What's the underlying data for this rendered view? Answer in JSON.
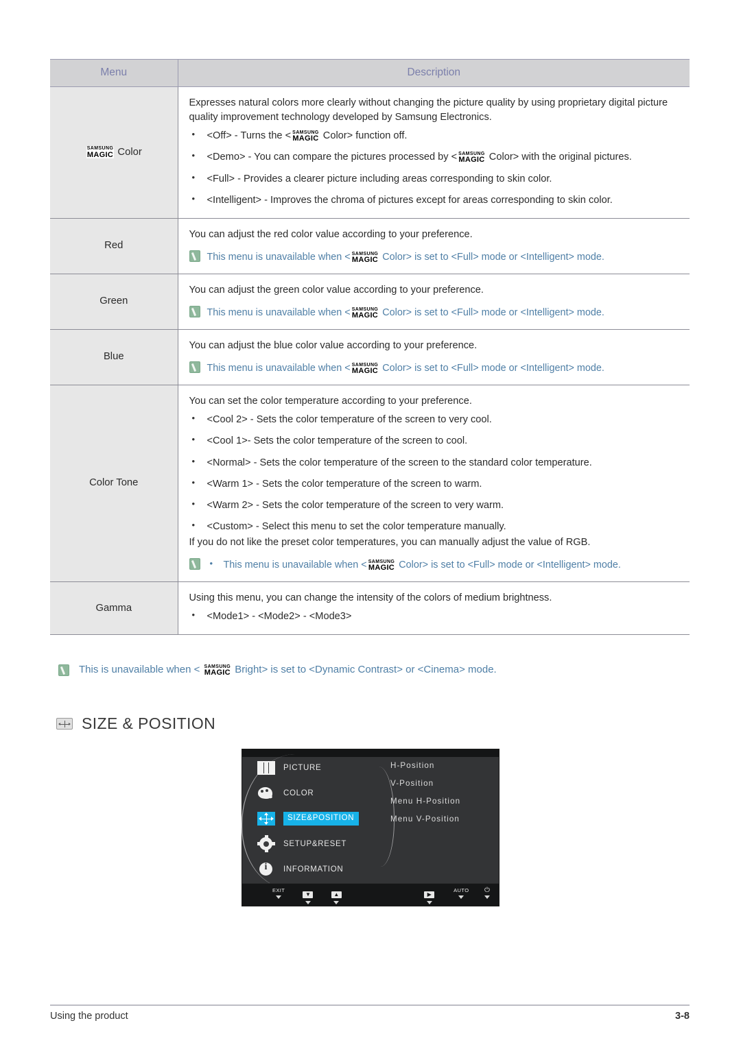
{
  "table": {
    "headers": {
      "menu": "Menu",
      "description": "Description"
    },
    "rows": [
      {
        "menu_prefix": "",
        "menu_magic": true,
        "menu_label": "Color",
        "intro": "Expresses natural colors more clearly without changing the picture quality by using proprietary digital picture quality improvement technology developed by Samsung Electronics.",
        "bullets": [
          {
            "pre": "<Off> - Turns the <",
            "magic": true,
            "post": " Color> function off."
          },
          {
            "pre": "<Demo> - You can compare the pictures processed by <",
            "magic": true,
            "post": " Color> with the original pictures."
          },
          {
            "pre": "<Full> - Provides a clearer picture including areas corresponding to skin color.",
            "magic": false,
            "post": ""
          },
          {
            "pre": "<Intelligent> - Improves the chroma of pictures except for areas corresponding to skin color.",
            "magic": false,
            "post": ""
          }
        ],
        "note": null
      },
      {
        "menu_label": "Red",
        "menu_magic": false,
        "intro": "You can adjust the red color value according to your preference.",
        "bullets": [],
        "note": {
          "pre": "This menu is unavailable when <",
          "magic": true,
          "post": " Color> is set to <Full> mode or <Intelligent> mode.",
          "bullet": false
        }
      },
      {
        "menu_label": "Green",
        "menu_magic": false,
        "intro": "You can adjust the green color value according to your preference.",
        "bullets": [],
        "note": {
          "pre": "This menu is unavailable when <",
          "magic": true,
          "post": " Color> is set to <Full> mode or <Intelligent> mode.",
          "bullet": false
        }
      },
      {
        "menu_label": "Blue",
        "menu_magic": false,
        "intro": "You can adjust the blue color value according to your preference.",
        "bullets": [],
        "note": {
          "pre": "This menu is unavailable when <",
          "magic": true,
          "post": " Color> is set to <Full> mode or <Intelligent> mode.",
          "bullet": false
        }
      },
      {
        "menu_label": "Color Tone",
        "menu_magic": false,
        "intro": "You can set the color temperature according to your preference.",
        "bullets": [
          {
            "pre": "<Cool 2> - Sets the color temperature of the screen to very cool.",
            "magic": false,
            "post": ""
          },
          {
            "pre": "<Cool 1>- Sets the color temperature of the screen to cool.",
            "magic": false,
            "post": ""
          },
          {
            "pre": "<Normal> - Sets the color temperature of the screen to the standard color temperature.",
            "magic": false,
            "post": ""
          },
          {
            "pre": "<Warm 1> - Sets the color temperature of the screen to warm.",
            "magic": false,
            "post": ""
          },
          {
            "pre": "<Warm 2> - Sets the color temperature of the screen to very warm.",
            "magic": false,
            "post": ""
          },
          {
            "pre": "<Custom> - Select this menu to set the color temperature manually.",
            "magic": false,
            "post": ""
          }
        ],
        "outro": "If you do not like the preset color temperatures, you can manually adjust the value of RGB.",
        "note": {
          "pre": "This menu is unavailable when <",
          "magic": true,
          "post": " Color> is set to <Full> mode or <Intelligent> mode.",
          "bullet": true
        }
      },
      {
        "menu_label": "Gamma",
        "menu_magic": false,
        "intro": "Using this menu, you can change the intensity of the colors of medium brightness.",
        "bullets": [
          {
            "pre": "<Mode1> - <Mode2> - <Mode3>",
            "magic": false,
            "post": ""
          }
        ],
        "note": null
      }
    ]
  },
  "standalone_note": {
    "pre": "This is unavailable when < ",
    "post": " Bright> is set to <Dynamic Contrast> or <Cinema> mode.",
    "icon": "note-pencil-icon"
  },
  "magic_logo": {
    "top": "SAMSUNG",
    "bottom": "MAGIC"
  },
  "section": {
    "title": "SIZE & POSITION",
    "icon": "size-position-icon"
  },
  "osd": {
    "left_menu": [
      {
        "label": "PICTURE",
        "icon": "picture-icon",
        "selected": false
      },
      {
        "label": "COLOR",
        "icon": "color-palette-icon",
        "selected": false
      },
      {
        "label": "SIZE&POSITION",
        "icon": "size-position-icon",
        "selected": true
      },
      {
        "label": "SETUP&RESET",
        "icon": "gear-icon",
        "selected": false
      },
      {
        "label": "INFORMATION",
        "icon": "info-icon",
        "selected": false
      }
    ],
    "right_items": [
      "H-Position",
      "V-Position",
      "Menu H-Position",
      "Menu V-Position"
    ],
    "buttons": [
      {
        "label": "EXIT",
        "glyph": "",
        "type": "text"
      },
      {
        "label": "",
        "glyph": "▼",
        "type": "cap"
      },
      {
        "label": "",
        "glyph": "▲",
        "type": "cap"
      },
      {
        "label": "",
        "glyph": "▶",
        "type": "cap"
      },
      {
        "label": "AUTO",
        "glyph": "",
        "type": "text"
      },
      {
        "label": "",
        "glyph": "⏻",
        "type": "power"
      }
    ],
    "accent_color": "#17b2e8"
  },
  "footer": {
    "left": "Using the product",
    "right": "3-8"
  },
  "colors": {
    "header_bg": "#d2d2d4",
    "header_text": "#7b7fab",
    "menu_cell_bg": "#e7e7e7",
    "note_blue": "#4f7fa6",
    "osd_bg": "#333436",
    "osd_accent": "#17b2e8"
  }
}
